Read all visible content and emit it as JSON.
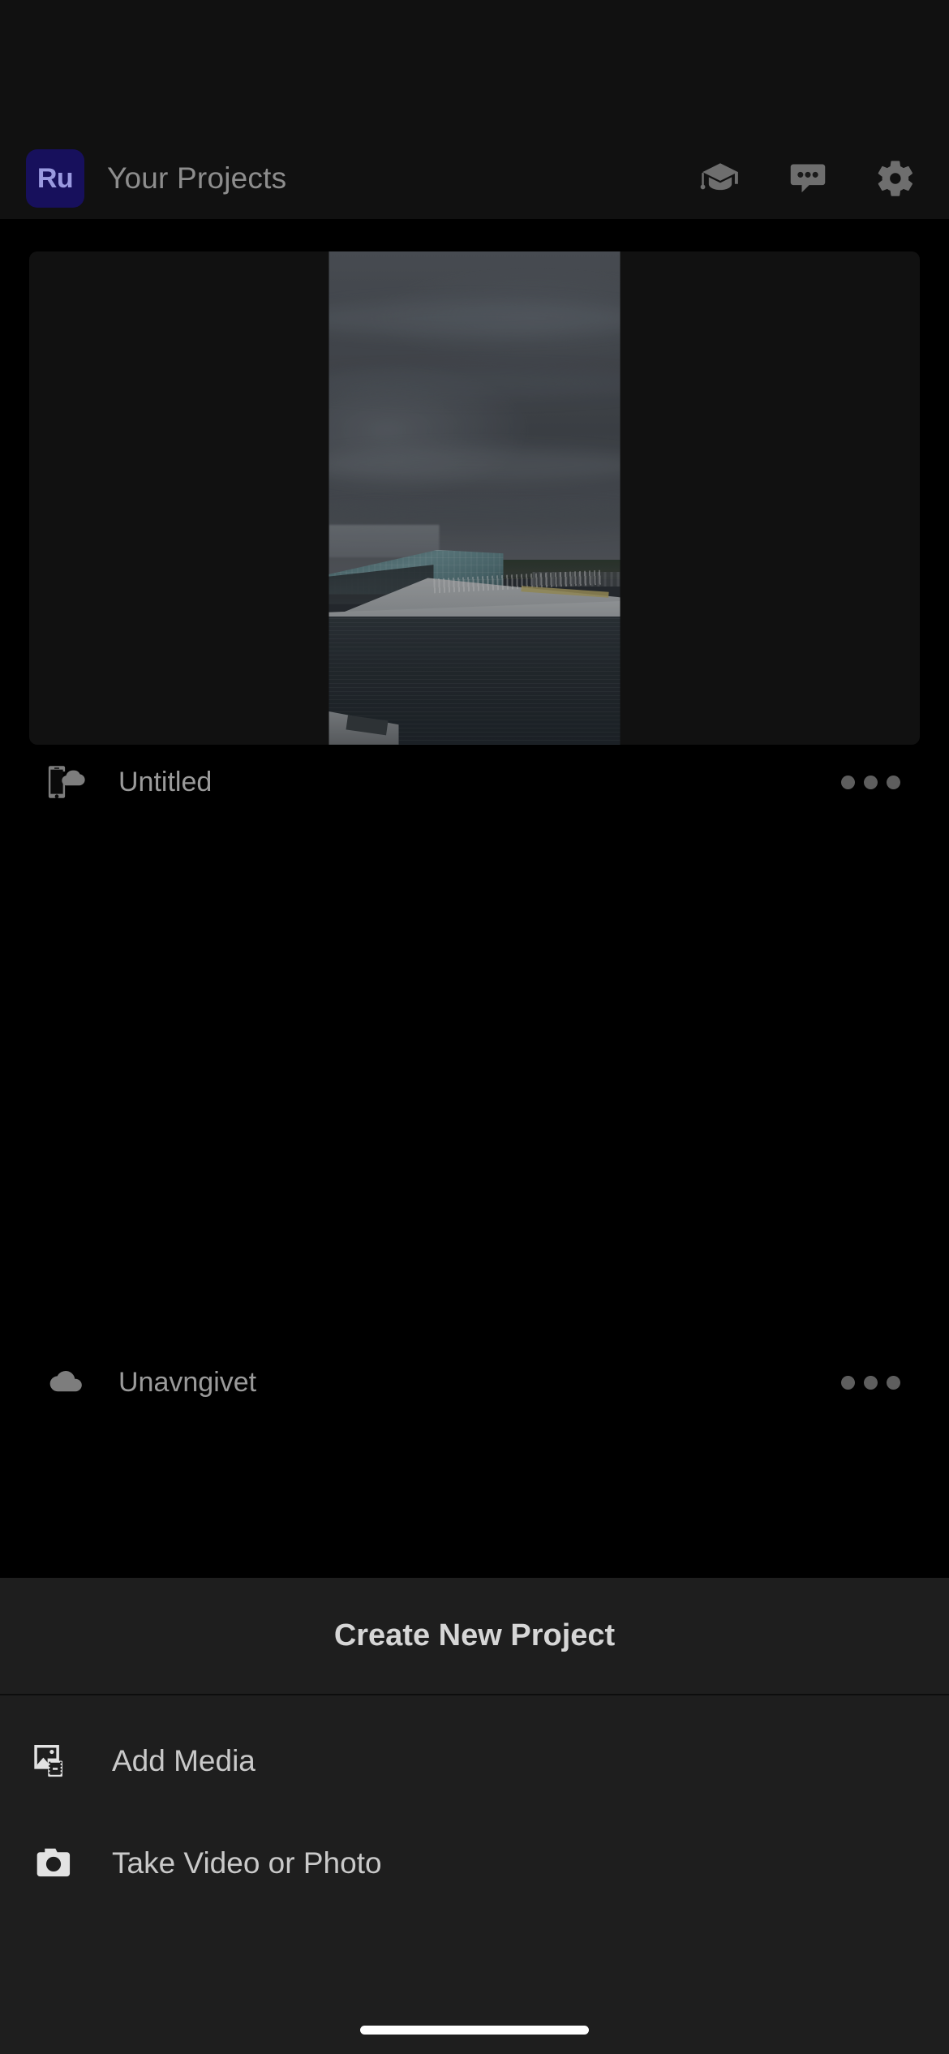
{
  "app": {
    "name": "Adobe Premiere Rush",
    "logo_text": "Ru",
    "logo_bg": "#17105c",
    "logo_fg": "#9a9ae0"
  },
  "header": {
    "title": "Your Projects",
    "actions": [
      {
        "name": "learn-icon",
        "label": "Learn"
      },
      {
        "name": "feedback-icon",
        "label": "Feedback"
      },
      {
        "name": "settings-icon",
        "label": "Settings"
      }
    ]
  },
  "projects": [
    {
      "name": "Untitled",
      "sync_icon": "device-cloud-icon",
      "thumbnail": "oslo-opera-house-overcast-photo",
      "more_label": "More options"
    },
    {
      "name": "Unavngivet",
      "sync_icon": "cloud-icon",
      "thumbnail": "black-empty-thumbnail",
      "more_label": "More options"
    }
  ],
  "sheet": {
    "title": "Create New Project",
    "items": [
      {
        "label": "Add Media",
        "icon": "media-library-icon"
      },
      {
        "label": "Take Video or Photo",
        "icon": "camera-icon"
      }
    ]
  },
  "colors": {
    "page_bg": "#000000",
    "header_bg": "#111111",
    "sheet_bg": "#1e1e1e",
    "text_muted": "#9a9a9a",
    "text_primary": "#c9c9c9",
    "icon_gray": "#6e6e6e"
  }
}
